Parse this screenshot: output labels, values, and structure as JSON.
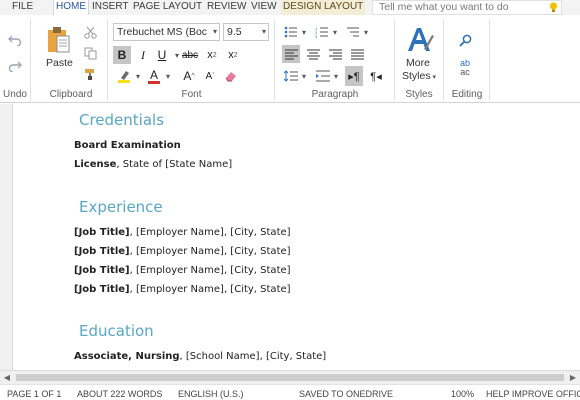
{
  "tabs": {
    "file": "FILE",
    "home": "HOME",
    "insert": "INSERT",
    "page_layout": "PAGE LAYOUT",
    "review": "REVIEW",
    "view": "VIEW",
    "design": "DESIGN",
    "layout": "LAYOUT"
  },
  "tell_me": {
    "placeholder": "Tell me what you want to do"
  },
  "ribbon": {
    "undo_group": "Undo",
    "clipboard": {
      "label": "Clipboard",
      "paste": "Paste"
    },
    "font": {
      "label": "Font",
      "family": "Trebuchet MS (Boc",
      "size": "9.5",
      "bold": "B",
      "italic": "I",
      "underline": "U",
      "strike": "abc",
      "subscript": "x",
      "subscript_mark": "2",
      "superscript": "x",
      "superscript_mark": "2",
      "font_color": "A",
      "grow": "A",
      "shrink": "A",
      "highlight_color": "#f4e11a",
      "font_color_value": "#d0312d"
    },
    "paragraph": {
      "label": "Paragraph"
    },
    "styles": {
      "label": "Styles",
      "more": "More",
      "styles_btn": "Styles"
    },
    "editing": {
      "label": "Editing",
      "replace_top": "ab",
      "replace_bottom": "ac"
    }
  },
  "document": {
    "sections": [
      {
        "heading": "Credentials",
        "lines": [
          {
            "bold": "Board Examination",
            "rest": ""
          },
          {
            "bold": "License",
            "rest": ", State of [State Name]"
          }
        ]
      },
      {
        "heading": "Experience",
        "lines": [
          {
            "bold": "[Job Title]",
            "rest": ", [Employer Name], [City, State]"
          },
          {
            "bold": "[Job Title]",
            "rest": ", [Employer Name], [City, State]"
          },
          {
            "bold": "[Job Title]",
            "rest": ", [Employer Name], [City, State]"
          },
          {
            "bold": "[Job Title]",
            "rest": ", [Employer Name], [City, State]"
          }
        ]
      },
      {
        "heading": "Education",
        "lines": [
          {
            "bold": "Associate, Nursing",
            "rest": ", [School Name], [City, State]"
          }
        ]
      }
    ]
  },
  "status": {
    "page": "PAGE 1 OF 1",
    "words": "ABOUT 222 WORDS",
    "language": "ENGLISH (U.S.)",
    "saved": "SAVED TO ONEDRIVE",
    "zoom": "100%",
    "help": "HELP IMPROVE OFFIC"
  },
  "colors": {
    "accent": "#2b579a",
    "heading": "#5aa6c5",
    "styles_icon": "#2f72b8"
  }
}
